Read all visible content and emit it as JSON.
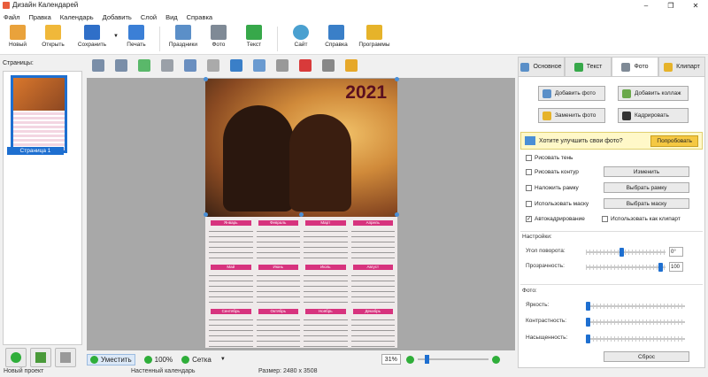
{
  "window": {
    "title": "Дизайн Календарей"
  },
  "menu": [
    "Файл",
    "Правка",
    "Календарь",
    "Добавить",
    "Слой",
    "Вид",
    "Справка"
  ],
  "toolbar": {
    "buttons": [
      {
        "label": "Новый",
        "icon": "new-doc-icon",
        "color": "#e9a23b"
      },
      {
        "label": "Открыть",
        "icon": "folder-icon",
        "color": "#f0b83a"
      },
      {
        "label": "Сохранить",
        "icon": "floppy-icon",
        "color": "#2f6fc8"
      },
      {
        "label": "Печать",
        "icon": "printer-icon",
        "color": "#3b7fd6"
      },
      {
        "label": "Праздники",
        "icon": "calendar-31-icon",
        "color": "#5b8fc8"
      },
      {
        "label": "Фото",
        "icon": "camera-icon",
        "color": "#7f8a96"
      },
      {
        "label": "Текст",
        "icon": "text-a-icon",
        "color": "#37a84a"
      },
      {
        "label": "Сайт",
        "icon": "globe-icon",
        "color": "#4aa0d0"
      },
      {
        "label": "Справка",
        "icon": "help-book-icon",
        "color": "#3a7fc8"
      },
      {
        "label": "Программы",
        "icon": "programs-icon",
        "color": "#e6b32a"
      }
    ]
  },
  "pages": {
    "label": "Страницы:",
    "thumb_label": "Страница 1"
  },
  "poster": {
    "year": "2021",
    "months": [
      "Январь",
      "Февраль",
      "Март",
      "Апрель",
      "Май",
      "Июнь",
      "Июль",
      "Август",
      "Сентябрь",
      "Октябрь",
      "Ноябрь",
      "Декабрь"
    ]
  },
  "bottom": {
    "fit": "Уместить",
    "zoom100": "100%",
    "grid": "Сетка",
    "zoom_value": "31%"
  },
  "status": {
    "project": "Новый проект",
    "type": "Настенный календарь",
    "size": "Размер: 2480 x 3508"
  },
  "tabs": [
    {
      "label": "Основное",
      "icon": "basic-icon",
      "active": false
    },
    {
      "label": "Текст",
      "icon": "text-tab-icon",
      "active": false
    },
    {
      "label": "Фото",
      "icon": "photo-tab-icon",
      "active": true
    },
    {
      "label": "Клипарт",
      "icon": "star-icon",
      "active": false
    }
  ],
  "photo_panel": {
    "add_photo": "Добавить фото",
    "add_collage": "Добавить коллаж",
    "replace_photo": "Заменить фото",
    "crop": "Кадрировать",
    "promo_text": "Хотите улучшить свои фото?",
    "promo_button": "Попробовать",
    "draw_shadow": "Рисовать тень",
    "draw_outline": "Рисовать контур",
    "change": "Изменить",
    "apply_frame": "Наложить рамку",
    "choose_frame": "Выбрать рамку",
    "use_mask": "Использовать маску",
    "choose_mask": "Выбрать маску",
    "autocrop": "Автокадрирование",
    "use_as_clipart": "Использовать как клипарт",
    "settings_label": "Настройки:",
    "rotation_label": "Угол поворота:",
    "rotation_value": "0°",
    "transparency_label": "Прозрачность:",
    "transparency_value": "100",
    "photo_label": "Фото:",
    "brightness": "Яркость:",
    "contrast": "Контрастность:",
    "saturation": "Насыщенность:",
    "reset": "Сброс"
  }
}
